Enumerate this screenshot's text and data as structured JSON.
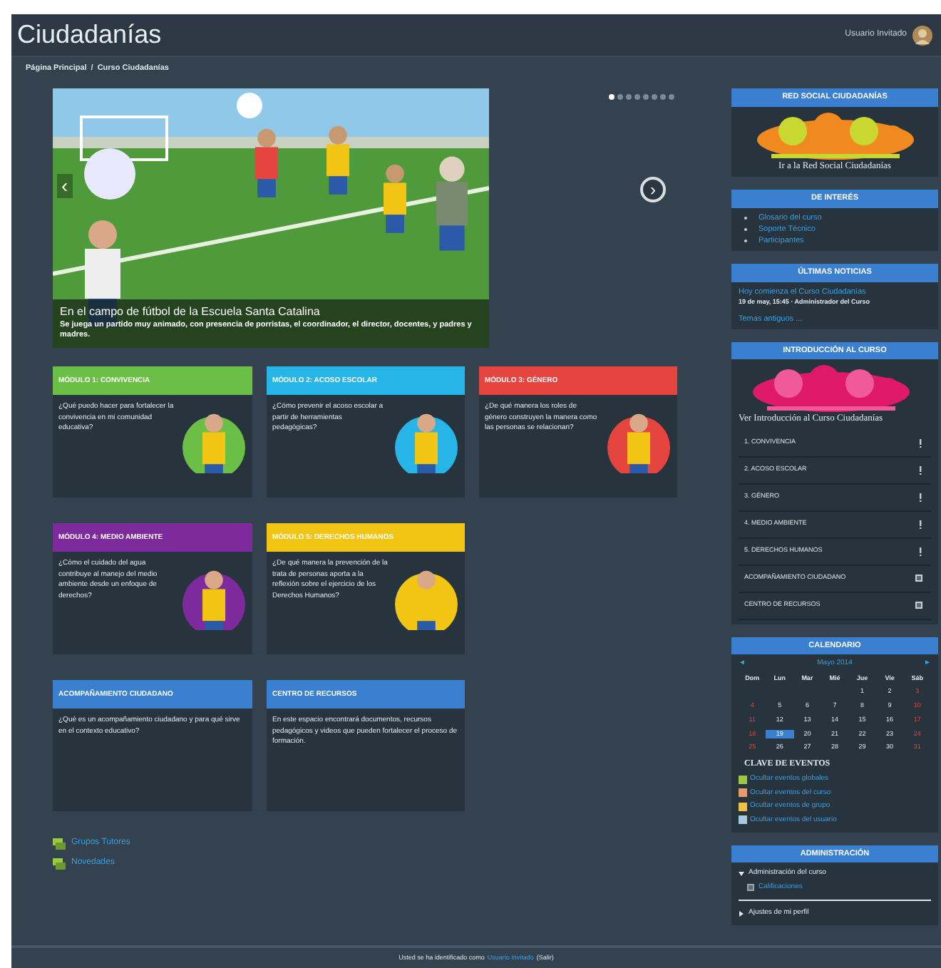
{
  "header": {
    "site_title": "Ciudadanías",
    "user_name": "Usuario Invitado",
    "breadcrumb": [
      "Página Principal",
      "Curso Ciudadanías"
    ],
    "breadcrumb_separator": "/"
  },
  "slider": {
    "caption_title": "En el campo de fútbol de la Escuela Santa Catalina",
    "caption_text": "Se juega un partido muy animado, con presencia de porristas, el coordinador, el director, docentes, y padres y madres.",
    "prev_arrow": "‹",
    "next_arrow": "›",
    "dots": [
      {
        "selected": true
      },
      {
        "selected": false
      },
      {
        "selected": false
      },
      {
        "selected": false
      },
      {
        "selected": false
      },
      {
        "selected": false
      },
      {
        "selected": false
      },
      {
        "selected": false
      }
    ]
  },
  "module_rows": [
    [
      {
        "title": "MÓDULO 1: CONVIVENCIA",
        "color": "#6bbf46",
        "text": "¿Qué puedo hacer para fortalecer la convivencia en mi comunidad educativa?"
      },
      {
        "title": "MÓDULO 2: ACOSO ESCOLAR",
        "color": "#27b4e6",
        "text": "¿Cómo prevenir el acoso escolar a partir de herramientas pedagógicas?"
      },
      {
        "title": "MÓDULO 3: GÉNERO",
        "color": "#e5443f",
        "text": "¿De qué manera los roles de género construyen la manera como las personas se relacionan?"
      }
    ],
    [
      {
        "title": "MÓDULO 4: MEDIO AMBIENTE",
        "color": "#7d2a9c",
        "text": "¿Cómo el cuidado del agua contribuye al manejo del medio ambiente desde un enfoque de derechos?"
      },
      {
        "title": "MÓDULO 5: DERECHOS HUMANOS",
        "color": "#f2c414",
        "text": "¿De qué manera la prevención de la trata de personas aporta a la reflexión sobre el ejercicio de los Derechos Humanos?"
      }
    ],
    [
      {
        "title": "ACOMPAÑAMIENTO CIUDADANO",
        "color": "#3a7fd0",
        "text": "¿Qué es un acompañamiento ciudadano y para qué sirve en el contexto educativo?"
      },
      {
        "title": "CENTRO DE RECURSOS",
        "color": "#3a7fd0",
        "text": "En este espacio encontrará documentos, recursos pedagógicos y videos que pueden fortalecer el proceso de formación."
      }
    ]
  ],
  "forums": [
    "Grupos Tutores",
    "Novedades"
  ],
  "sidebar": {
    "social": {
      "title": "RED SOCIAL CIUDADANÍAS",
      "caption": "Ir a la Red Social Ciudadanías"
    },
    "interest": {
      "title": "DE INTERÉS",
      "links": [
        "Glosario del curso",
        "Soporte Técnico",
        "Participantes"
      ]
    },
    "news": {
      "title": "ÚLTIMAS NOTICIAS",
      "headline": "Hoy comienza el Curso Ciudadanías",
      "meta": "19 de may, 15:45 · Administrador del Curso",
      "older": "Temas antiguos ..."
    },
    "intro": {
      "title": "INTRODUCCIÓN AL CURSO",
      "caption": "Ver Introducción al Curso Ciudadanías",
      "items": [
        {
          "label": "1. CONVIVENCIA",
          "kind": "module"
        },
        {
          "label": "2. ACOSO ESCOLAR",
          "kind": "module"
        },
        {
          "label": "3. GÉNERO",
          "kind": "module"
        },
        {
          "label": "4. MEDIO AMBIENTE",
          "kind": "module"
        },
        {
          "label": "5. DERECHOS HUMANOS",
          "kind": "module"
        },
        {
          "label": "ACOMPAÑAMIENTO CIUDADANO",
          "kind": "resource"
        },
        {
          "label": "CENTRO DE RECURSOS",
          "kind": "resource"
        }
      ]
    },
    "calendar": {
      "title": "CALENDARIO",
      "prev": "◄",
      "month": "Mayo 2014",
      "next": "►",
      "weekdays": [
        "Dom",
        "Lun",
        "Mar",
        "Mié",
        "Jue",
        "Vie",
        "Sáb"
      ],
      "weeks": [
        [
          {
            "kind": "blank"
          },
          {
            "kind": "blank"
          },
          {
            "kind": "blank"
          },
          {
            "kind": "blank"
          },
          {
            "day": "1",
            "weekend": false,
            "selected": false
          },
          {
            "day": "2",
            "weekend": false,
            "selected": false
          },
          {
            "day": "3",
            "weekend": true,
            "selected": false
          }
        ],
        [
          {
            "day": "4",
            "weekend": true,
            "selected": false
          },
          {
            "day": "5",
            "weekend": false,
            "selected": false
          },
          {
            "day": "6",
            "weekend": false,
            "selected": false
          },
          {
            "day": "7",
            "weekend": false,
            "selected": false
          },
          {
            "day": "8",
            "weekend": false,
            "selected": false
          },
          {
            "day": "9",
            "weekend": false,
            "selected": false
          },
          {
            "day": "10",
            "weekend": true,
            "selected": false
          }
        ],
        [
          {
            "day": "11",
            "weekend": true,
            "selected": false
          },
          {
            "day": "12",
            "weekend": false,
            "selected": false
          },
          {
            "day": "13",
            "weekend": false,
            "selected": false
          },
          {
            "day": "14",
            "weekend": false,
            "selected": false
          },
          {
            "day": "15",
            "weekend": false,
            "selected": false
          },
          {
            "day": "16",
            "weekend": false,
            "selected": false
          },
          {
            "day": "17",
            "weekend": true,
            "selected": false
          }
        ],
        [
          {
            "day": "18",
            "weekend": true,
            "selected": false
          },
          {
            "day": "19",
            "weekend": false,
            "selected": true
          },
          {
            "day": "20",
            "weekend": false,
            "selected": false
          },
          {
            "day": "21",
            "weekend": false,
            "selected": false
          },
          {
            "day": "22",
            "weekend": false,
            "selected": false
          },
          {
            "day": "23",
            "weekend": false,
            "selected": false
          },
          {
            "day": "24",
            "weekend": true,
            "selected": false
          }
        ],
        [
          {
            "day": "25",
            "weekend": true,
            "selected": false
          },
          {
            "day": "26",
            "weekend": false,
            "selected": false
          },
          {
            "day": "27",
            "weekend": false,
            "selected": false
          },
          {
            "day": "28",
            "weekend": false,
            "selected": false
          },
          {
            "day": "29",
            "weekend": false,
            "selected": false
          },
          {
            "day": "30",
            "weekend": false,
            "selected": false
          },
          {
            "day": "31",
            "weekend": true,
            "selected": false
          }
        ]
      ],
      "key_title": "CLAVE DE EVENTOS",
      "key": [
        {
          "label": "Ocultar eventos globales",
          "color": "#9cc845"
        },
        {
          "label": "Ocultar eventos del curso",
          "color": "#e89a6a"
        },
        {
          "label": "Ocultar eventos de grupo",
          "color": "#f0c040"
        },
        {
          "label": "Ocultar eventos del usuario",
          "color": "#a8c8e0"
        }
      ]
    },
    "admin": {
      "title": "ADMINISTRACIÓN",
      "tree": [
        {
          "label": "Administración del curso",
          "expanded": true,
          "children": [
            {
              "label": "Calificaciones"
            }
          ]
        },
        {
          "label": "Ajustes de mi perfil",
          "expanded": false
        }
      ]
    }
  },
  "footer": {
    "text": "Usted se ha identificado como ",
    "user_link": "Usuario Invitado",
    "logout": "(Salir)"
  }
}
